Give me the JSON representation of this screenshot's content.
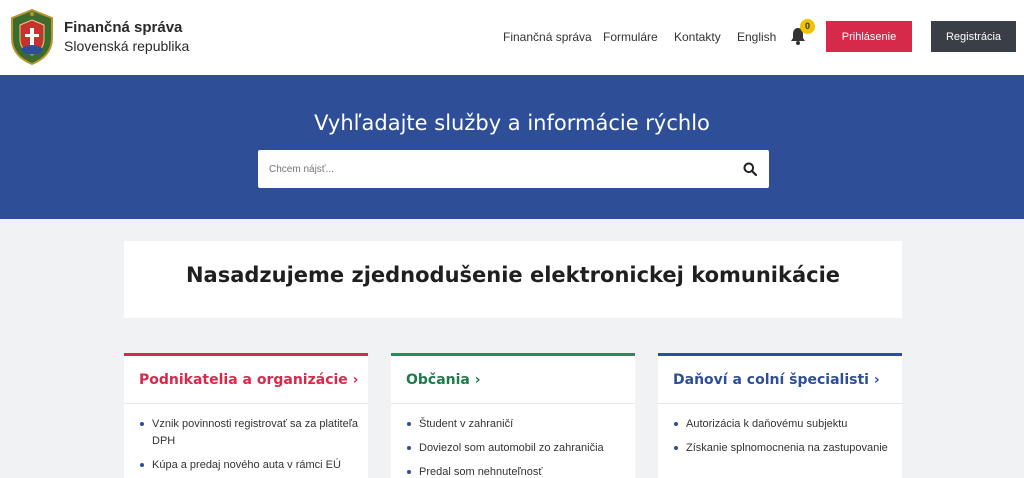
{
  "header": {
    "logo_title": "Finančná správa",
    "logo_subtitle": "Slovenská republika",
    "crest_icon": "state-crest-icon",
    "nav": [
      {
        "label": "Finančná správa"
      },
      {
        "label": "Formuláre"
      },
      {
        "label": "Kontakty"
      },
      {
        "label": "English"
      }
    ],
    "notification_count": "0",
    "login_label": "Prihlásenie",
    "register_label": "Registrácia"
  },
  "hero": {
    "title": "Vyhľadajte služby a informácie rýchlo",
    "search_placeholder": "Chcem nájsť...",
    "search_icon": "search-icon"
  },
  "announcement": {
    "text": "Nasadzujeme zjednodušenie elektronickej komunikácie"
  },
  "cards": [
    {
      "title": "Podnikatelia a organizácie ›",
      "items": [
        "Vznik povinnosti registrovať sa za platiteľa DPH",
        "Kúpa a predaj nového auta v rámci EÚ"
      ]
    },
    {
      "title": "Občania ›",
      "items": [
        "Študent v zahraničí",
        "Doviezol som automobil zo zahraničia",
        "Predal som nehnuteľnosť"
      ]
    },
    {
      "title": "Daňoví a colní špecialisti ›",
      "items": [
        "Autorizácia k daňovému subjektu",
        "Získanie splnomocnenia na zastupovanie"
      ]
    }
  ],
  "colors": {
    "brand_blue": "#2e4f98",
    "accent_red": "#d7294a",
    "accent_green": "#2a8a5a",
    "dark_button": "#3a3f47"
  }
}
